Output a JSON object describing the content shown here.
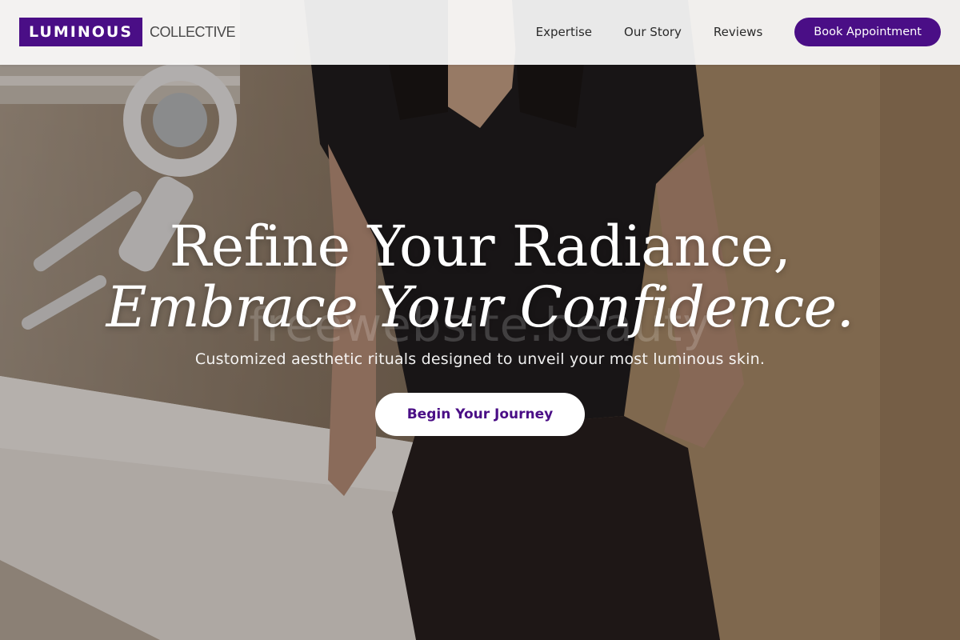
{
  "brand": {
    "logo_box_text": "LUMINOUS",
    "logo_suffix": "COLLECTIVE",
    "accent_color": "#4a0e86"
  },
  "nav": {
    "items": [
      {
        "label": "Expertise"
      },
      {
        "label": "Our Story"
      },
      {
        "label": "Reviews"
      }
    ],
    "book_label": "Book Appointment"
  },
  "hero": {
    "headline_line1": "Refine Your Radiance,",
    "headline_line2": "Embrace Your Confidence.",
    "watermark": "freewebsite.beauty",
    "subhead": "Customized aesthetic rituals designed to unveil your most luminous skin.",
    "cta_label": "Begin Your Journey",
    "background_image": "esthetician-in-treatment-room-photo"
  }
}
